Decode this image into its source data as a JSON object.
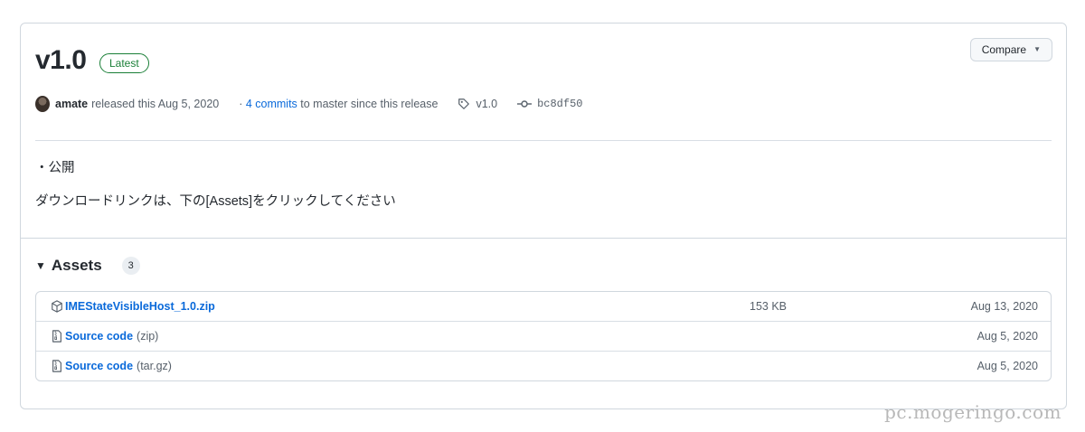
{
  "release": {
    "title": "v1.0",
    "badge": "Latest",
    "compare_label": "Compare",
    "author": "amate",
    "released_text": "released this Aug 5, 2020",
    "commits_prefix": "· ",
    "commits_link": "4 commits",
    "commits_suffix": " to master since this release",
    "tag": "v1.0",
    "commit_sha": "bc8df50"
  },
  "notes": {
    "line1": "・公開",
    "line2": "ダウンロードリンクは、下の[Assets]をクリックしてください"
  },
  "assets": {
    "heading": "Assets",
    "count": "3",
    "items": [
      {
        "name": "IMEStateVisibleHost_1.0.zip",
        "sub": "",
        "size": "153 KB",
        "date": "Aug 13, 2020",
        "icon": "package-icon"
      },
      {
        "name": "Source code",
        "sub": "(zip)",
        "size": "",
        "date": "Aug 5, 2020",
        "icon": "file-zip-icon"
      },
      {
        "name": "Source code",
        "sub": "(tar.gz)",
        "size": "",
        "date": "Aug 5, 2020",
        "icon": "file-zip-icon"
      }
    ]
  },
  "watermark": "pc.mogeringo.com",
  "colors": {
    "link": "#0969da",
    "latest_green": "#1a7f37",
    "border": "#d0d7de"
  }
}
